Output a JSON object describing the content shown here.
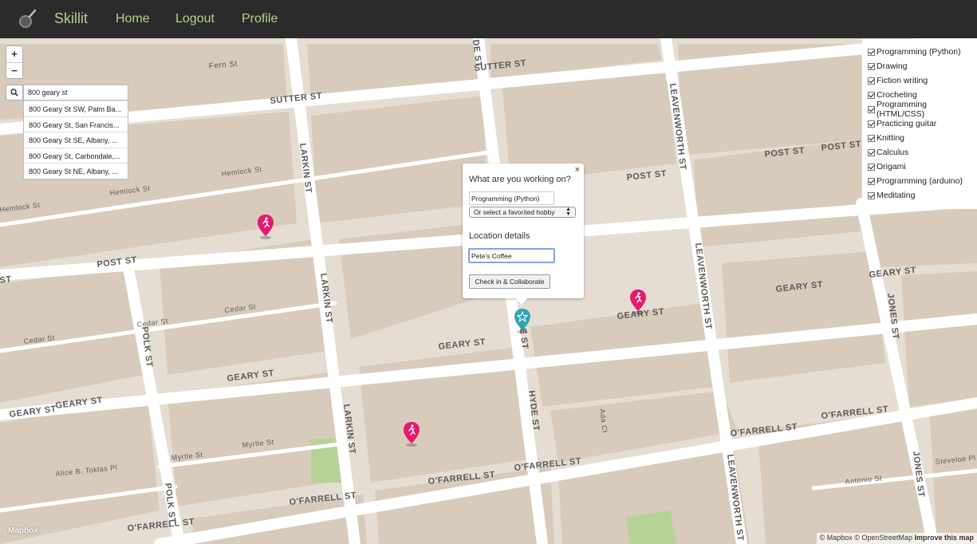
{
  "navbar": {
    "brand": "Skillit",
    "links": [
      "Home",
      "Logout",
      "Profile"
    ]
  },
  "map": {
    "zoom_in": "+",
    "zoom_out": "−",
    "streets": {
      "fern": "Fern St",
      "sutter_w": "SUTTER ST",
      "sutter_e": "SUTTER ST",
      "hemlock_1": "Hemlock St",
      "hemlock_2": "Hemlock St",
      "hemlock_3": "Hemlock St",
      "post_w": "POST ST",
      "post_e1": "POST ST",
      "post_e2": "POST ST",
      "post_e3": "POST ST",
      "post_frag": "ST",
      "cedar_1": "Cedar St",
      "cedar_2": "Cedar St",
      "cedar_3": "Cedar St",
      "geary_1": "GEARY ST",
      "geary_2": "GEARY ST",
      "geary_3": "GEARY ST",
      "geary_4": "GEARY ST",
      "geary_5": "GEARY ST",
      "geary_6": "GEARY ST",
      "geary_7": "GEARY ST",
      "myrtle_1": "Myrtle St",
      "myrtle_2": "Myrtle St",
      "ofarrell_1": "O'FARRELL ST",
      "ofarrell_2": "O'FARRELL ST",
      "ofarrell_3": "O'FARRELL ST",
      "ofarrell_4": "O'FARRELL ST",
      "ofarrell_5": "O'FARRELL ST",
      "ofarrell_6": "O'FARRELL ST",
      "alice": "Alice B. Toklas Pl",
      "antonio": "Antonio St",
      "steveloe": "Steveloe Pl",
      "ada": "Ada Ct",
      "larkin_1": "LARKIN ST",
      "larkin_2": "LARKIN ST",
      "larkin_3": "LARKIN ST",
      "polk_1": "POLK ST",
      "polk_2": "POLK ST",
      "hyde_1": "HYDE ST",
      "hyde_top": "DE ST",
      "hyde_frag": "E ST",
      "leav_1": "LEAVENWORTH ST",
      "leav_2": "LEAVENWORTH ST",
      "leav_3": "LEAVENWORTH ST",
      "jones_1": "JONES ST",
      "jones_2": "JONES ST"
    },
    "attribution": "© Mapbox © OpenStreetMap",
    "improve": "Improve this map",
    "logo": "Mapbox"
  },
  "geocoder": {
    "value": "800 geary st",
    "results": [
      "800 Geary St SW, Palm Ba...",
      "800 Geary St, San Francis...",
      "800 Geary St SE, Albany, ...",
      "800 Geary St, Carbondale,...",
      "800 Geary St NE, Albany, ..."
    ]
  },
  "hobbies": [
    "Programming (Python)",
    "Drawing",
    "Fiction writing",
    "Crocheting",
    "Programming (HTML/CSS)",
    "Practicing guitar",
    "Knitting",
    "Calculus",
    "Origami",
    "Programming (arduino)",
    "Meditating"
  ],
  "popup": {
    "close": "×",
    "title": "What are you working on?",
    "hobby_value": "Programming (Python)",
    "select_label": "Or select a favorited hobby",
    "location_label": "Location details",
    "location_value": "Pete's Coffee",
    "submit": "Check in & Collaborate"
  },
  "colors": {
    "navbar": "#2b2b2b",
    "brand": "#b5d18a",
    "marker_pink": "#e8196e",
    "marker_teal": "#2aa5b5",
    "map_bg": "#e6ddd2",
    "block": "#d9ccbc",
    "road": "#ffffff"
  }
}
